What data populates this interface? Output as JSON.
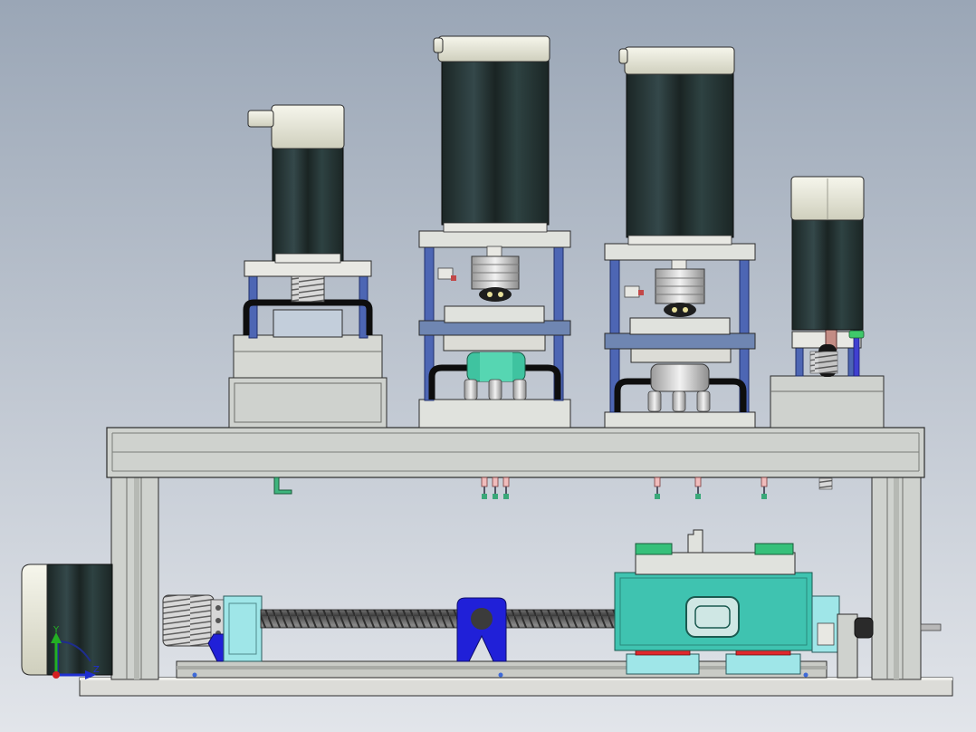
{
  "view": {
    "background_top": "#9aa6b6",
    "background_bottom": "#e2e5ea"
  },
  "colors": {
    "frame": "#cfd2ce",
    "frame_edge": "#2b2b2b",
    "motor_body": "#253332",
    "motor_cap": "#ededdf",
    "rod_blue": "#4d66b4",
    "plate_blue": "#6f86b2",
    "teal": "#3fc3b0",
    "green_part": "#3aa879",
    "red_pad": "#e0272b",
    "cyan_part": "#9fe6e8",
    "royal_blue": "#2020d8"
  },
  "triad": {
    "y_label": "Y",
    "z_label": "Z",
    "y_color": "#23b023",
    "z_color": "#1f2fd0",
    "x_color": "#d42020"
  }
}
